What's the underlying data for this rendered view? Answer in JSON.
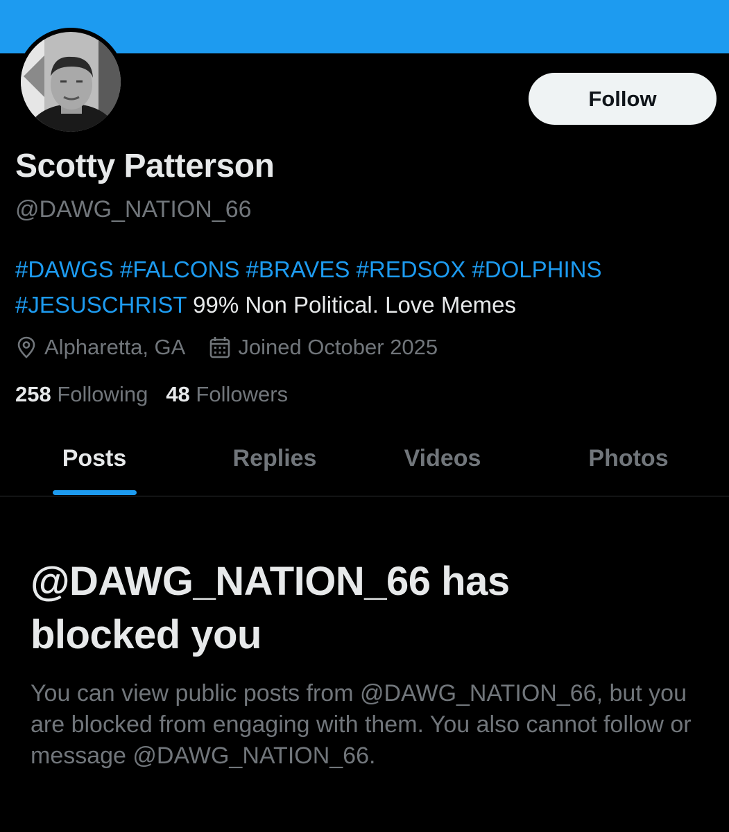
{
  "profile": {
    "display_name": "Scotty Patterson",
    "handle": "@DAWG_NATION_66",
    "bio_hashtags": [
      "#DAWGS",
      "#FALCONS",
      "#BRAVES",
      "#REDSOX",
      "#DOLPHINS",
      "#JESUSCHRIST"
    ],
    "bio_text": "99% Non Political. Love Memes",
    "location": "Alpharetta, GA",
    "joined": "Joined October 2025",
    "following_count": "258",
    "following_label": "Following",
    "followers_count": "48",
    "followers_label": "Followers",
    "avatar_icon": "profile-photo"
  },
  "actions": {
    "follow_label": "Follow"
  },
  "tabs": [
    {
      "label": "Posts",
      "active": true
    },
    {
      "label": "Replies",
      "active": false
    },
    {
      "label": "Videos",
      "active": false
    },
    {
      "label": "Photos",
      "active": false
    }
  ],
  "blocked": {
    "title": "@DAWG_NATION_66 has blocked you",
    "message": "You can view public posts from @DAWG_NATION_66, but you are blocked from engaging with them. You also cannot follow or message @DAWG_NATION_66."
  },
  "icons": {
    "location": "location-pin-icon",
    "calendar": "calendar-icon"
  },
  "colors": {
    "banner": "#1d9bf0",
    "accent": "#1d9bf0",
    "background": "#000000",
    "primary_text": "#e7e9ea",
    "secondary_text": "#71767b",
    "follow_button_bg": "#eff3f4"
  }
}
